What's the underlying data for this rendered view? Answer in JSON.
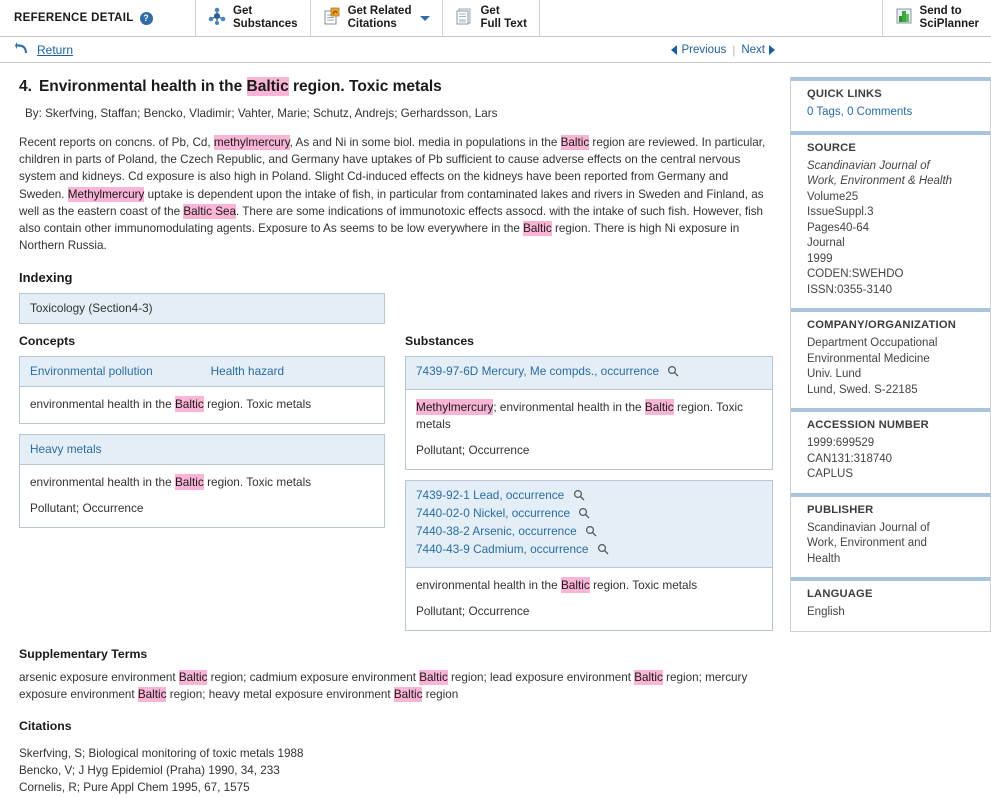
{
  "toolbar": {
    "title": "REFERENCE DETAIL",
    "help_icon": "help-icon",
    "buttons": [
      {
        "label": "Get\nSubstances",
        "icon": "molecule-icon",
        "caret": false
      },
      {
        "label": "Get Related\nCitations",
        "icon": "documents-icon",
        "caret": true
      },
      {
        "label": "Get\nFull Text",
        "icon": "page-icon",
        "caret": false
      }
    ],
    "send_to": {
      "label": "Send to\nSciPlanner",
      "icon": "sciplanner-icon"
    }
  },
  "subnav": {
    "return_label": "Return",
    "return_icon": "return-arrow-icon",
    "previous_label": "Previous",
    "next_label": "Next",
    "separator": "|"
  },
  "record": {
    "number": "4.",
    "title_part1": "Environmental health in the ",
    "title_highlight": "Baltic",
    "title_part2": " region. Toxic metals",
    "authors": "By: Skerfving, Staffan; Bencko, Vladimir; Vahter, Marie; Schutz, Andrejs; Gerhardsson, Lars",
    "abstract": [
      {
        "t": "Recent reports on concns. of Pb, Cd, "
      },
      {
        "t": "methylmercury",
        "h": true
      },
      {
        "t": ", As and Ni in some biol. media in populations in the "
      },
      {
        "t": "Baltic",
        "h": true
      },
      {
        "t": " region are reviewed.  In particular, children in parts of Poland, the Czech Republic, and Germany have uptakes of Pb sufficient to cause adverse effects on the central nervous system and kidneys.  Cd exposure is also high in Poland.  Slight Cd-induced effects on the kidneys have been reported from Germany and Sweden.  "
      },
      {
        "t": "Methylmercury",
        "h": true
      },
      {
        "t": " uptake is dependent upon the intake of fish, in particular from contaminated lakes and rivers in Sweden and Finland, as well as the eastern coast of the "
      },
      {
        "t": "Baltic Sea",
        "h": true
      },
      {
        "t": ".  There are some indications of immunotoxic effects assocd. with the intake of such fish.  However, fish also contain other immunomodulating agents.  Exposure to As seems to be low everywhere in the "
      },
      {
        "t": "Baltic",
        "h": true
      },
      {
        "t": " region.  There is high Ni exposure in Northern Russia."
      }
    ]
  },
  "indexing": {
    "heading": "Indexing",
    "section": "Toxicology (Section4-3)"
  },
  "concepts": {
    "heading": "Concepts",
    "groups": [
      {
        "headers": [
          "Environmental pollution",
          "Health hazard"
        ],
        "lines": [
          [
            {
              "t": "environmental health in the "
            },
            {
              "t": "Baltic",
              "h": true
            },
            {
              "t": " region. Toxic metals"
            }
          ]
        ]
      },
      {
        "headers": [
          "Heavy metals"
        ],
        "lines": [
          [
            {
              "t": "environmental health in the "
            },
            {
              "t": "Baltic",
              "h": true
            },
            {
              "t": " region. Toxic metals"
            }
          ],
          [
            {
              "t": "Pollutant; Occurrence"
            }
          ]
        ]
      }
    ]
  },
  "substances": {
    "heading": "Substances",
    "groups": [
      {
        "entries": [
          {
            "cas": "7439-97-6D",
            "name": "Mercury, Me compds., occurrence",
            "icon": "magnifier-icon"
          }
        ],
        "lines": [
          [
            {
              "t": "Methylmercury",
              "h": true
            },
            {
              "t": "; environmental health in the "
            },
            {
              "t": "Baltic",
              "h": true
            },
            {
              "t": " region. Toxic metals"
            }
          ],
          [
            {
              "t": "Pollutant; Occurrence"
            }
          ]
        ]
      },
      {
        "entries": [
          {
            "cas": "7439-92-1",
            "name": "Lead, occurrence",
            "icon": "magnifier-icon"
          },
          {
            "cas": "7440-02-0",
            "name": "Nickel, occurrence",
            "icon": "magnifier-icon"
          },
          {
            "cas": "7440-38-2",
            "name": "Arsenic, occurrence",
            "icon": "magnifier-icon"
          },
          {
            "cas": "7440-43-9",
            "name": "Cadmium, occurrence",
            "icon": "magnifier-icon"
          }
        ],
        "lines": [
          [
            {
              "t": "environmental health in the "
            },
            {
              "t": "Baltic",
              "h": true
            },
            {
              "t": " region. Toxic metals"
            }
          ],
          [
            {
              "t": "Pollutant; Occurrence"
            }
          ]
        ]
      }
    ]
  },
  "supplementary": {
    "heading": "Supplementary Terms",
    "parts": [
      {
        "t": "arsenic exposure environment "
      },
      {
        "t": "Baltic",
        "h": true
      },
      {
        "t": " region; cadmium exposure environment "
      },
      {
        "t": "Baltic",
        "h": true
      },
      {
        "t": " region; lead exposure environment "
      },
      {
        "t": "Baltic",
        "h": true
      },
      {
        "t": " region; mercury exposure environment "
      },
      {
        "t": "Baltic",
        "h": true
      },
      {
        "t": " region; heavy metal exposure environment "
      },
      {
        "t": "Baltic",
        "h": true
      },
      {
        "t": " region"
      }
    ]
  },
  "citations": {
    "heading": "Citations",
    "items": [
      "Skerfving, S; Biological monitoring of toxic metals 1988",
      "Bencko, V; J Hyg Epidemiol (Praha) 1990, 34, 233",
      "Cornelis, R; Pure Appl Chem 1995, 67, 1575"
    ]
  },
  "sidebar": {
    "sections": [
      {
        "heading": "QUICK LINKS",
        "values": [
          {
            "text": "0 Tags, 0 Comments",
            "link": true
          }
        ]
      },
      {
        "heading": "SOURCE",
        "values": [
          {
            "text": "Scandinavian Journal of",
            "italic": true
          },
          {
            "text": "Work, Environment & Health",
            "italic": true
          },
          {
            "text": "Volume25"
          },
          {
            "text": "IssueSuppl.3"
          },
          {
            "text": "Pages40-64"
          },
          {
            "text": "Journal"
          },
          {
            "text": "1999"
          },
          {
            "text": "CODEN:SWEHDO"
          },
          {
            "text": "ISSN:0355-3140"
          }
        ]
      },
      {
        "heading": "COMPANY/ORGANIZATION",
        "values": [
          {
            "text": "Department Occupational"
          },
          {
            "text": "Environmental Medicine"
          },
          {
            "text": "Univ. Lund"
          },
          {
            "text": "Lund, Swed.  S-22185"
          }
        ]
      },
      {
        "heading": "ACCESSION NUMBER",
        "values": [
          {
            "text": "1999:699529"
          },
          {
            "text": "CAN131:318740"
          },
          {
            "text": "CAPLUS"
          }
        ]
      },
      {
        "heading": "PUBLISHER",
        "values": [
          {
            "text": "Scandinavian Journal of"
          },
          {
            "text": "Work, Environment and"
          },
          {
            "text": "Health"
          }
        ]
      },
      {
        "heading": "LANGUAGE",
        "values": [
          {
            "text": "English"
          }
        ]
      }
    ]
  },
  "colors": {
    "link": "#2a6ca3",
    "highlight": "#fab4d6",
    "panel_header_bg": "#e4eef6",
    "panel_border": "#b9c6d2",
    "sidebar_divider": "#a8c4dd"
  }
}
